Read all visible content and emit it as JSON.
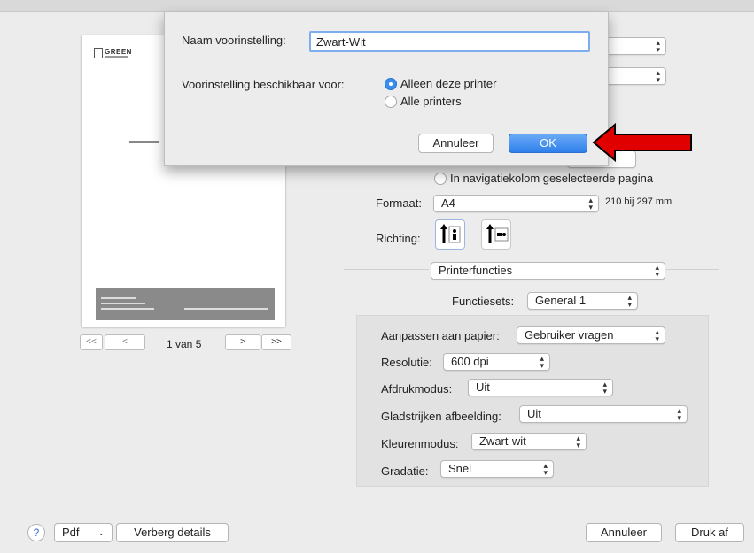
{
  "dialog": {
    "preset_name_label": "Naam voorinstelling:",
    "preset_name_value": "Zwart-Wit",
    "availability_label": "Voorinstelling beschikbaar voor:",
    "option_this_printer": "Alleen deze printer",
    "option_all_printers": "Alle printers",
    "cancel_label": "Annuleer",
    "ok_label": "OK"
  },
  "preview": {
    "logo_text": "GREEN",
    "page_indicator": "1 van 5",
    "nav_first": "<<",
    "nav_prev": "<",
    "nav_next": ">",
    "nav_last": ">>"
  },
  "settings": {
    "selected_pages_option": "In navigatiekolom geselecteerde pagina",
    "format_label": "Formaat:",
    "format_value": "A4",
    "format_size": "210 bij 297 mm",
    "orientation_label": "Richting:",
    "section_value": "Printerfuncties",
    "function_sets_label": "Functiesets:",
    "function_sets_value": "General 1"
  },
  "printer_features": {
    "fit_label": "Aanpassen aan papier:",
    "fit_value": "Gebruiker vragen",
    "resolution_label": "Resolutie:",
    "resolution_value": "600 dpi",
    "print_mode_label": "Afdrukmodus:",
    "print_mode_value": "Uit",
    "smoothing_label": "Gladstrijken afbeelding:",
    "smoothing_value": "Uit",
    "color_mode_label": "Kleurenmodus:",
    "color_mode_value": "Zwart-wit",
    "gradation_label": "Gradatie:",
    "gradation_value": "Snel"
  },
  "footer": {
    "help": "?",
    "pdf_label": "Pdf",
    "hide_details_label": "Verberg details",
    "cancel_label": "Annuleer",
    "print_label": "Druk af"
  },
  "colors": {
    "accent_blue": "#3b8ef0",
    "arrow_red": "#e00000"
  }
}
